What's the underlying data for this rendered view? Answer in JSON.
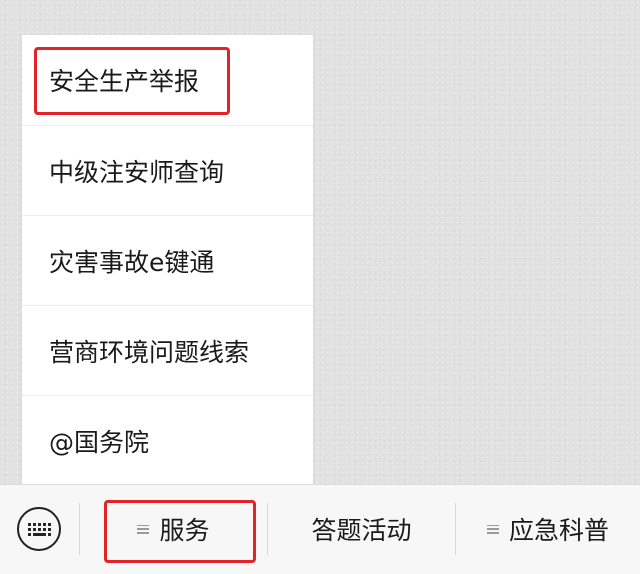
{
  "menu": {
    "items": [
      {
        "label": "安全生产举报"
      },
      {
        "label": "中级注安师查询"
      },
      {
        "label": "灾害事故e键通"
      },
      {
        "label": "营商环境问题线索"
      },
      {
        "label": "@国务院"
      }
    ]
  },
  "bottom_bar": {
    "keyboard_icon": "keyboard-icon",
    "tabs": [
      {
        "label": "服务",
        "icon": "menu-lines-icon"
      },
      {
        "label": "答题活动"
      },
      {
        "label": "应急科普",
        "icon": "menu-lines-icon"
      }
    ]
  },
  "highlight_color": "#e0242a"
}
